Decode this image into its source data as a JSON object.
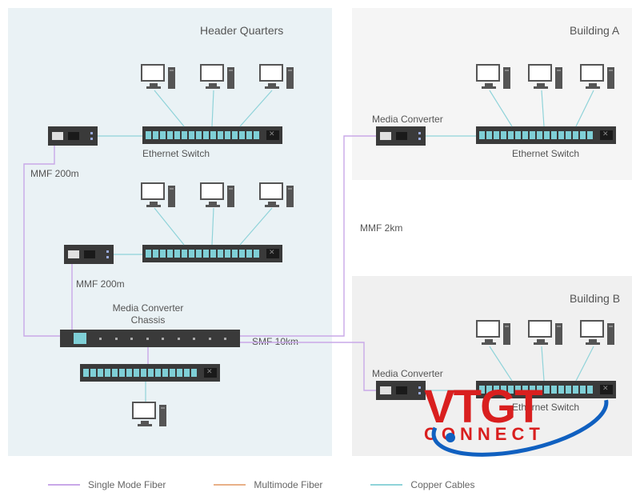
{
  "zones": {
    "hq": "Header Quarters",
    "a": "Building A",
    "b": "Building B"
  },
  "labels": {
    "ethernet_switch": "Ethernet Switch",
    "media_converter": "Media Converter",
    "media_converter_chassis_l1": "Media Converter",
    "media_converter_chassis_l2": "Chassis",
    "mmf_200m": "MMF 200m",
    "mmf_2km": "MMF 2km",
    "smf_10km": "SMF 10km"
  },
  "legend": {
    "smf": "Single Mode Fiber",
    "mmf": "Multimode Fiber",
    "copper": "Copper Cables"
  },
  "logo": {
    "brand": "VTGT",
    "sub": "CONNECT"
  },
  "colors": {
    "smf": "#c9a8e8",
    "mmf_legend": "#e8b088",
    "copper": "#8fd3d9",
    "zone_hq": "#eaf2f5",
    "zone_other": "#f2f2f2"
  },
  "diagram": {
    "buildings": [
      "Header Quarters",
      "Building A",
      "Building B"
    ],
    "links": [
      {
        "from": "HQ media converter 1",
        "to": "HQ media converter 2",
        "type": "MMF",
        "length": "200m"
      },
      {
        "from": "HQ media converter 2",
        "to": "HQ chassis",
        "type": "MMF",
        "length": "200m"
      },
      {
        "from": "HQ chassis",
        "to": "Building A media converter",
        "type": "MMF",
        "length": "2km"
      },
      {
        "from": "HQ chassis",
        "to": "Building B media converter",
        "type": "SMF",
        "length": "10km"
      },
      {
        "from": "HQ chassis",
        "to": "HQ bottom switch",
        "type": "SMF",
        "length": ""
      }
    ],
    "devices_per_switch_pcs": 3
  }
}
